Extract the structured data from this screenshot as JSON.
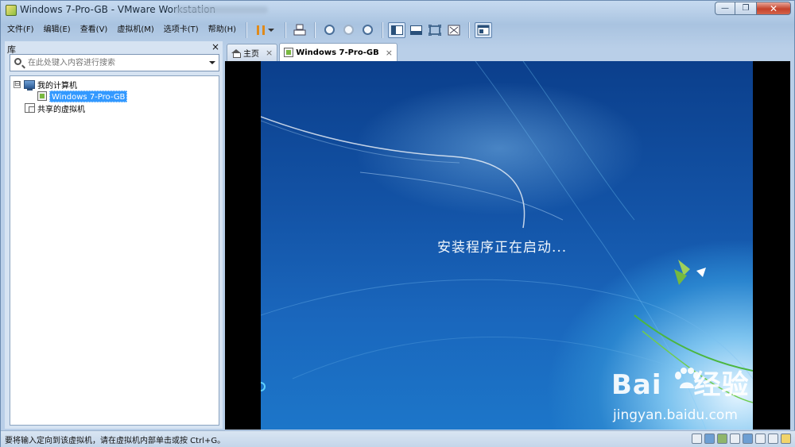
{
  "window": {
    "title": "Windows 7-Pro-GB - VMware Workstation",
    "buttons": {
      "minimize": "—",
      "restore": "❐",
      "close": "✕"
    }
  },
  "menubar": {
    "items": [
      "文件(F)",
      "编辑(E)",
      "查看(V)",
      "虚拟机(M)",
      "选项卡(T)",
      "帮助(H)"
    ]
  },
  "toolbar": {
    "icons": [
      "pause-icon",
      "send-ctrl-alt-del-icon",
      "snapshot-icon",
      "revert-snapshot-icon",
      "snapshot-manager-icon",
      "library-view-icon",
      "thumbnail-bar-icon",
      "full-screen-icon",
      "unity-icon",
      "console-view-icon"
    ]
  },
  "library": {
    "title": "库",
    "close": "×",
    "search_placeholder": "在此处键入内容进行搜索",
    "tree": [
      {
        "label": "我的计算机",
        "expander": "⊟"
      },
      {
        "label": "Windows 7-Pro-GB",
        "selected": true
      },
      {
        "label": "共享的虚拟机"
      }
    ]
  },
  "tabs": [
    {
      "label": "主页",
      "close": "×"
    },
    {
      "label": "Windows 7-Pro-GB",
      "close": "×",
      "active": true
    }
  ],
  "vm": {
    "message": "安装程序正在启动..."
  },
  "watermark": {
    "logo_left": "Bai",
    "logo_right": "经验",
    "url": "jingyan.baidu.com"
  },
  "statusbar": {
    "text": "要将输入定向到该虚拟机，请在虚拟机内部单击或按 Ctrl+G。"
  },
  "colors": {
    "accent": "#3399ff",
    "desktop_blue": "#1353a6",
    "frame": "#b9cfe8"
  }
}
